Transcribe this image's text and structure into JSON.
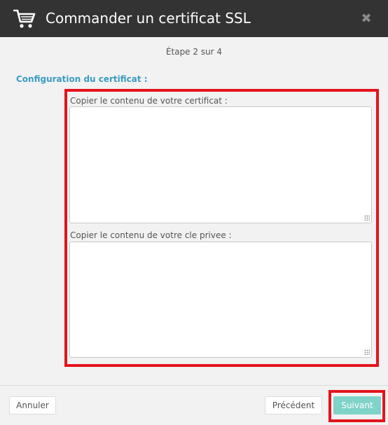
{
  "header": {
    "title": "Commander un certificat SSL",
    "close_glyph": "✖",
    "cart_icon": "cart-icon"
  },
  "step": "Étape 2 sur 4",
  "section_title": "Configuration du certificat :",
  "fields": {
    "certificate_label": "Copier le contenu de votre certificat :",
    "certificate_value": "",
    "private_key_label": "Copier le contenu de votre cle privee :",
    "private_key_value": ""
  },
  "buttons": {
    "cancel": "Annuler",
    "previous": "Précédent",
    "next": "Suivant"
  },
  "colors": {
    "header_bg": "#333333",
    "accent_title": "#3a9bc4",
    "next_button": "#7fd3c9",
    "highlight": "#e3141d"
  }
}
